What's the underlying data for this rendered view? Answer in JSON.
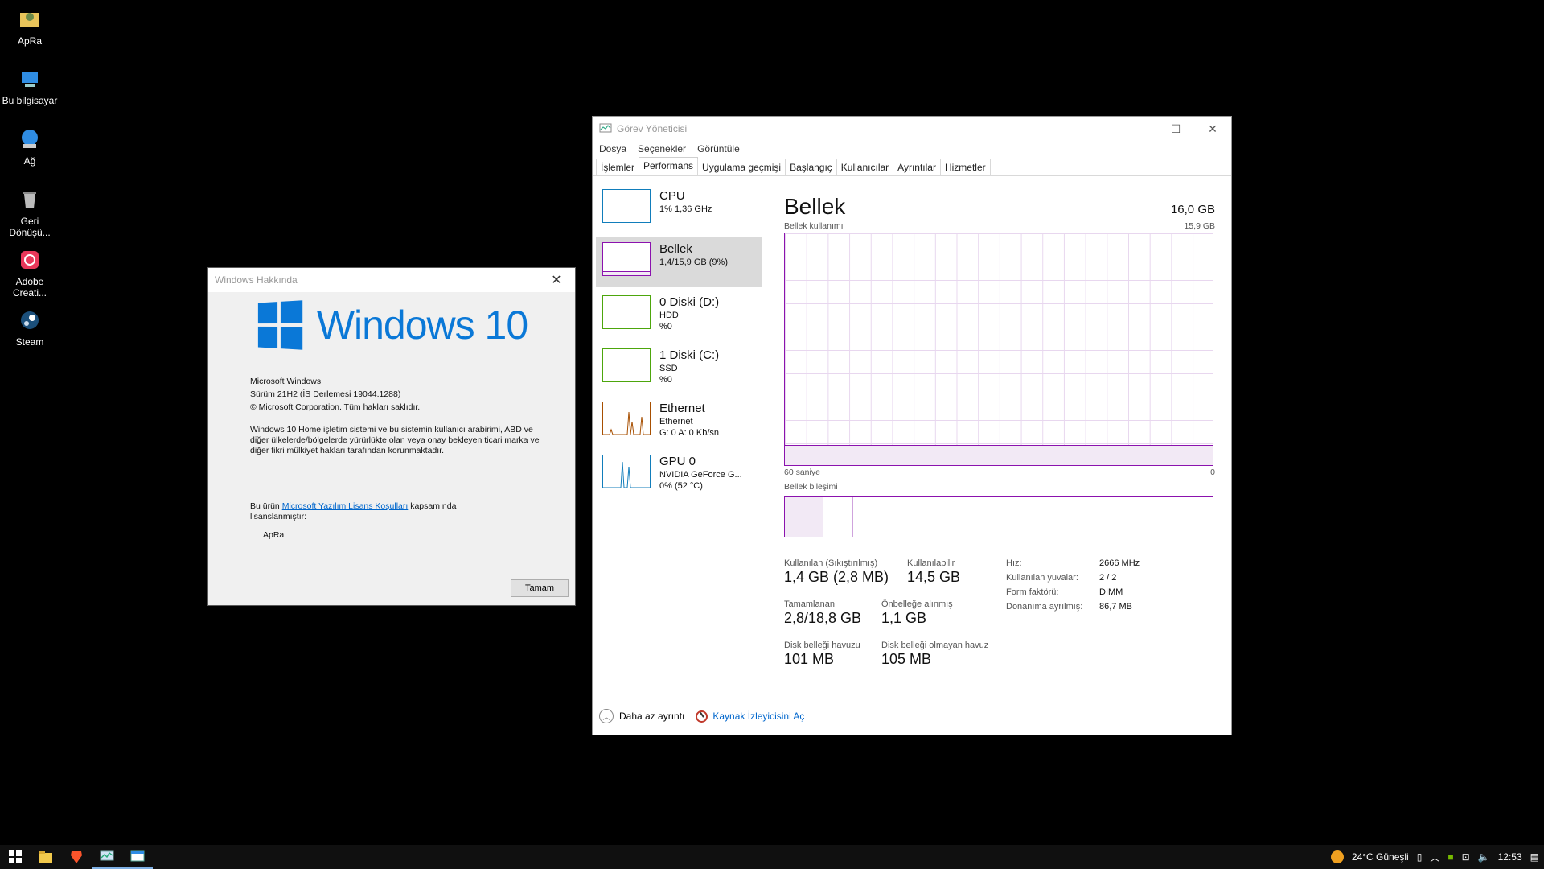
{
  "desktop": {
    "icons": [
      {
        "label": "ApRa",
        "icon": "user-folder-icon"
      },
      {
        "label": "Bu bilgisayar",
        "icon": "computer-icon"
      },
      {
        "label": "Ağ",
        "icon": "network-icon"
      },
      {
        "label": "Geri Dönüşü...",
        "icon": "recycle-bin-icon"
      },
      {
        "label": "Adobe Creati...",
        "icon": "adobe-cc-icon"
      },
      {
        "label": "Steam",
        "icon": "steam-icon"
      }
    ]
  },
  "about": {
    "title": "Windows Hakkında",
    "logo_text": "Windows 10",
    "product": "Microsoft Windows",
    "version": "Sürüm 21H2 (İS Derlemesi 19044.1288)",
    "copyright": "© Microsoft Corporation. Tüm hakları saklıdır.",
    "description": "Windows 10 Home işletim sistemi ve bu sistemin kullanıcı arabirimi, ABD ve diğer ülkelerde/bölgelerde yürürlükte olan veya onay bekleyen ticari marka ve diğer fikri mülkiyet hakları tarafından korunmaktadır.",
    "license_prefix": "Bu ürün ",
    "license_link": "Microsoft Yazılım Lisans Koşulları",
    "license_suffix": " kapsamında lisanslanmıştır:",
    "licensee": "ApRa",
    "ok_label": "Tamam"
  },
  "taskmgr": {
    "title": "Görev Yöneticisi",
    "menu": [
      "Dosya",
      "Seçenekler",
      "Görüntüle"
    ],
    "tabs": [
      "İşlemler",
      "Performans",
      "Uygulama geçmişi",
      "Başlangıç",
      "Kullanıcılar",
      "Ayrıntılar",
      "Hizmetler"
    ],
    "active_tab": "Performans",
    "sidebar": [
      {
        "name": "CPU",
        "line2": "1%  1,36 GHz",
        "line3": "",
        "color": "#117dbb"
      },
      {
        "name": "Bellek",
        "line2": "1,4/15,9 GB (9%)",
        "line3": "",
        "color": "#8b12ae"
      },
      {
        "name": "0 Diski (D:)",
        "line2": "HDD",
        "line3": "%0",
        "color": "#4da60c"
      },
      {
        "name": "1 Diski (C:)",
        "line2": "SSD",
        "line3": "%0",
        "color": "#4da60c"
      },
      {
        "name": "Ethernet",
        "line2": "Ethernet",
        "line3": "G: 0 A: 0 Kb/sn",
        "color": "#a74f01"
      },
      {
        "name": "GPU 0",
        "line2": "NVIDIA GeForce G...",
        "line3": "0%  (52 °C)",
        "color": "#117dbb"
      }
    ],
    "panel": {
      "title": "Bellek",
      "total": "16,0 GB",
      "usage_label": "Bellek kullanımı",
      "usage_max": "15,9 GB",
      "time_left": "60 saniye",
      "time_right": "0",
      "composition_label": "Bellek bileşimi",
      "stats": {
        "in_use_label": "Kullanılan (Sıkıştırılmış)",
        "in_use_value": "1,4 GB (2,8 MB)",
        "available_label": "Kullanılabilir",
        "available_value": "14,5 GB",
        "committed_label": "Tamamlanan",
        "committed_value": "2,8/18,8 GB",
        "cached_label": "Önbelleğe alınmış",
        "cached_value": "1,1 GB",
        "paged_label": "Disk belleği havuzu",
        "paged_value": "101 MB",
        "nonpaged_label": "Disk belleği olmayan havuz",
        "nonpaged_value": "105 MB"
      },
      "properties": [
        {
          "k": "Hız:",
          "v": "2666 MHz"
        },
        {
          "k": "Kullanılan yuvalar:",
          "v": "2 / 2"
        },
        {
          "k": "Form faktörü:",
          "v": "DIMM"
        },
        {
          "k": "Donanıma ayrılmış:",
          "v": "86,7 MB"
        }
      ]
    },
    "footer": {
      "fewer_details": "Daha az ayrıntı",
      "resource_monitor": "Kaynak İzleyicisini Aç"
    }
  },
  "taskbar": {
    "weather": "24°C  Güneşli",
    "time": "12:53"
  }
}
